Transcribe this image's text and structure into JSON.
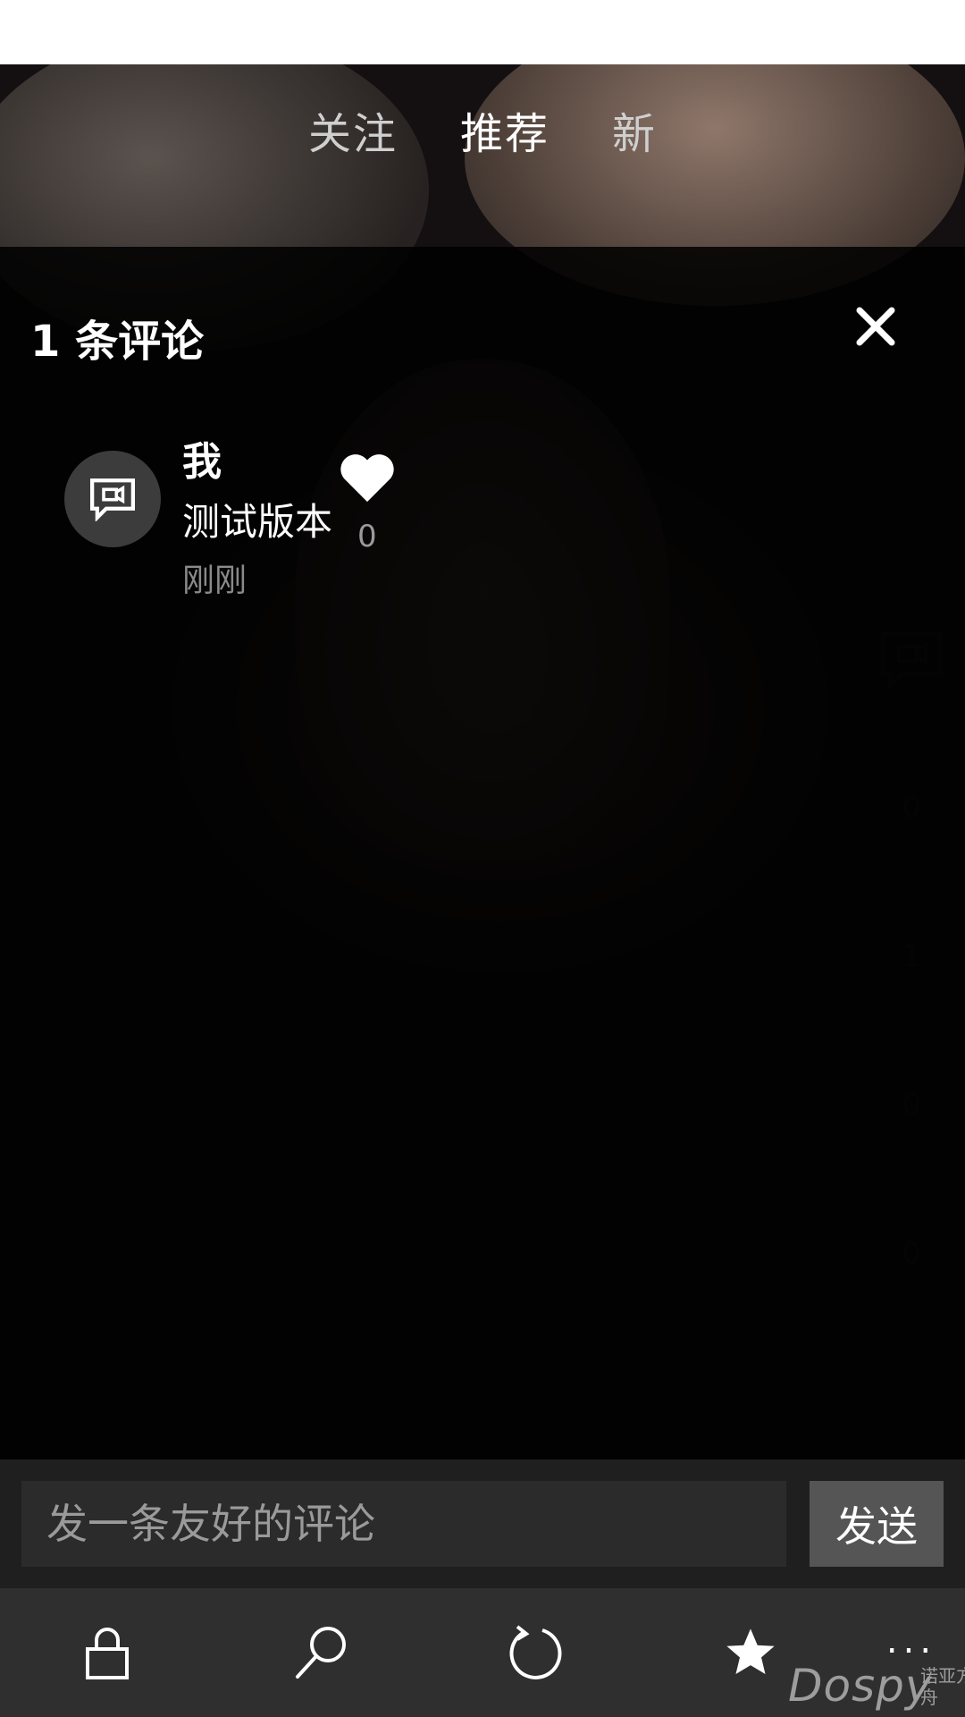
{
  "top_tabs": [
    {
      "label": "关注",
      "active": false
    },
    {
      "label": "推荐",
      "active": true
    },
    {
      "label": "新",
      "active": false
    }
  ],
  "side_rail": {
    "like_count": "0",
    "comment_count": "1",
    "favorite_count": "0",
    "share_count": "0"
  },
  "comments_panel": {
    "title": "1 条评论",
    "comments": [
      {
        "author": "我",
        "text": "测试版本",
        "time": "刚刚",
        "likes": "0"
      }
    ]
  },
  "input_bar": {
    "placeholder": "发一条友好的评论",
    "send_label": "发送"
  },
  "app_bar": {
    "items": [
      "lock-icon",
      "search-icon",
      "refresh-icon",
      "star-icon"
    ],
    "more_label": "..."
  },
  "watermark": {
    "brand": "Dospy",
    "sub": "诺亚方舟"
  },
  "colors": {
    "overlay": "#000000",
    "input_bar": "#1f1f1f",
    "app_bar": "#2f2f2f",
    "send_button": "#555555"
  }
}
